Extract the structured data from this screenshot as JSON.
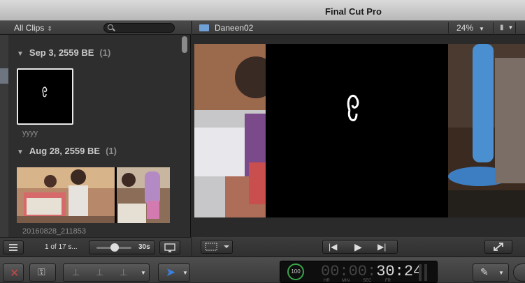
{
  "app": {
    "title": "Final Cut Pro"
  },
  "browser": {
    "filter_label": "All Clips",
    "groups": [
      {
        "date": "Sep 3, 2559 BE",
        "count": "(1)",
        "clips": [
          {
            "label": "yyyy"
          }
        ]
      },
      {
        "date": "Aug 28, 2559 BE",
        "count": "(1)",
        "clips": [
          {
            "label": "20160828_211853"
          }
        ]
      }
    ],
    "footer": {
      "selection_text": "1 of 17 s...",
      "duration_label": "30s"
    }
  },
  "viewer": {
    "clip_name": "Daneen02",
    "zoom": "24%"
  },
  "timecode": {
    "dim_part": "00:00:",
    "lit_part": "30:24",
    "units": [
      "HR",
      "MIN",
      "SEC",
      "FR"
    ],
    "gauge_value": "100"
  },
  "colors": {
    "accent": "#3a7fe0",
    "gauge": "#3aa34a"
  }
}
